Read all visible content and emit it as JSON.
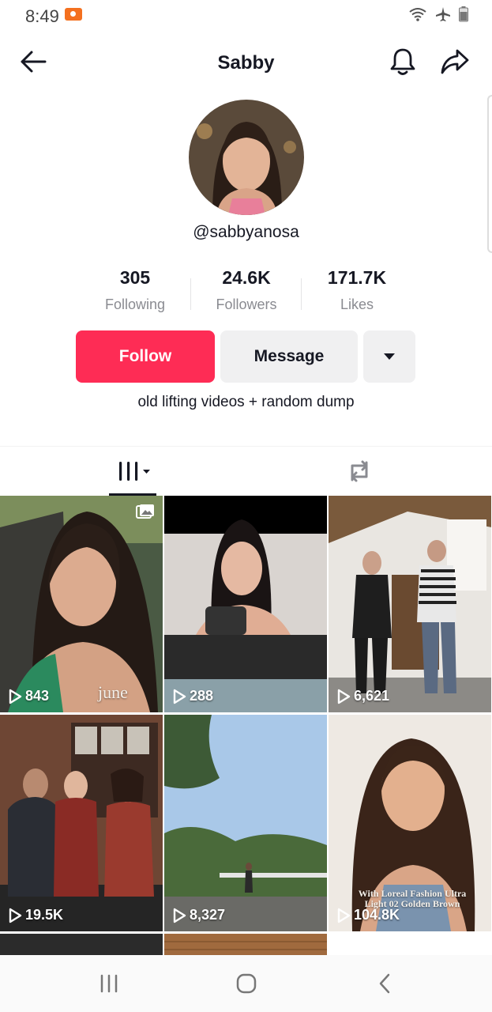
{
  "status_bar": {
    "time": "8:49"
  },
  "header": {
    "title": "Sabby"
  },
  "profile": {
    "username": "@sabbyanosa",
    "bio": "old lifting videos + random dump",
    "stats": [
      {
        "value": "305",
        "label": "Following"
      },
      {
        "value": "24.6K",
        "label": "Followers"
      },
      {
        "value": "171.7K",
        "label": "Likes"
      }
    ]
  },
  "actions": {
    "follow_label": "Follow",
    "message_label": "Message"
  },
  "colors": {
    "accent": "#fe2c55",
    "secondary_button": "#f0f0f1"
  },
  "videos": [
    {
      "views": "843",
      "caption": "june"
    },
    {
      "views": "288"
    },
    {
      "views": "6,621"
    },
    {
      "views": "19.5K"
    },
    {
      "views": "8,327"
    },
    {
      "views": "104.8K",
      "caption": "With Loreal Fashion Ultra Light 02 Golden Brown"
    }
  ],
  "icons": [
    "back-arrow-icon",
    "bell-icon",
    "share-icon",
    "grid-icon",
    "repost-icon",
    "play-icon",
    "photo-icon",
    "recents-icon",
    "home-icon",
    "back-icon"
  ]
}
